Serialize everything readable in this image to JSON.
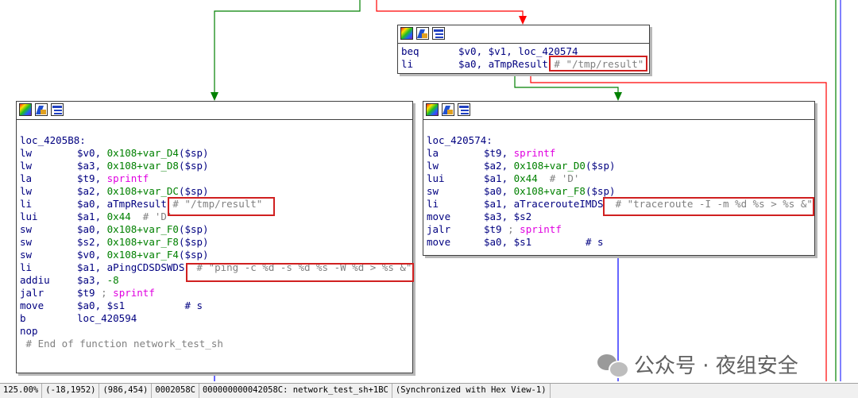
{
  "colors": {
    "mnemonic": "#000080",
    "function": "#e000e0",
    "number": "#008000",
    "comment": "#808080",
    "highlight": "#d02020",
    "edge_true": "#008000",
    "edge_false": "#ff0000",
    "edge_normal": "#0000ff"
  },
  "toolbar_icons": [
    "palette-icon",
    "edit-node-icon",
    "assembly-view-icon"
  ],
  "blocks": {
    "top": {
      "lines": [
        {
          "mn": "beq",
          "op": "$v0, $v1, loc_420574"
        },
        {
          "mn": "li",
          "op": "$a0, aTmpResult",
          "cm": "# \"/tmp/result\""
        }
      ]
    },
    "left": {
      "label": "loc_4205B8:",
      "lines": [
        {
          "mn": "lw",
          "op_pre": "$v0, ",
          "num": "0x108+var_D4",
          "op_post": "($sp)"
        },
        {
          "mn": "lw",
          "op_pre": "$a3, ",
          "num": "0x108+var_D8",
          "op_post": "($sp)"
        },
        {
          "mn": "la",
          "op_pre": "$t9, ",
          "fn": "sprintf"
        },
        {
          "mn": "lw",
          "op_pre": "$a2, ",
          "num": "0x108+var_DC",
          "op_post": "($sp)"
        },
        {
          "mn": "li",
          "op_pre": "$a0, aTmpResult ",
          "cm": "# \"/tmp/result\""
        },
        {
          "mn": "lui",
          "op_pre": "$a1, ",
          "num": "0x44",
          "cm": "  # 'D'"
        },
        {
          "mn": "sw",
          "op_pre": "$a0, ",
          "num": "0x108+var_F0",
          "op_post": "($sp)"
        },
        {
          "mn": "sw",
          "op_pre": "$s2, ",
          "num": "0x108+var_F8",
          "op_post": "($sp)"
        },
        {
          "mn": "sw",
          "op_pre": "$v0, ",
          "num": "0x108+var_F4",
          "op_post": "($sp)"
        },
        {
          "mn": "li",
          "op_pre": "$a1, aPingCDSDSWDS",
          "cm": "  # \"ping -c %d -s %d %s -W %d > %s &\""
        },
        {
          "mn": "addiu",
          "op_pre": "$a3, ",
          "num": "-8"
        },
        {
          "mn": "jalr",
          "op_pre": "$t9 ",
          "cm_fn": "; ",
          "fn": "sprintf"
        },
        {
          "mn": "move",
          "op_pre": "$a0, $s1",
          "op_post": "          # s"
        },
        {
          "mn": "b",
          "op_pre": "loc_420594"
        },
        {
          "mn": "nop",
          "op_pre": ""
        }
      ],
      "footer": " # End of function network_test_sh"
    },
    "right": {
      "label": "loc_420574:",
      "lines": [
        {
          "mn": "la",
          "op_pre": "$t9, ",
          "fn": "sprintf"
        },
        {
          "mn": "lw",
          "op_pre": "$a2, ",
          "num": "0x108+var_D0",
          "op_post": "($sp)"
        },
        {
          "mn": "lui",
          "op_pre": "$a1, ",
          "num": "0x44",
          "cm": "  # 'D'"
        },
        {
          "mn": "sw",
          "op_pre": "$a0, ",
          "num": "0x108+var_F8",
          "op_post": "($sp)"
        },
        {
          "mn": "li",
          "op_pre": "$a1, aTracerouteIMDS",
          "cm": "  # \"traceroute -I -m %d %s > %s &\""
        },
        {
          "mn": "move",
          "op_pre": "$a3, $s2"
        },
        {
          "mn": "jalr",
          "op_pre": "$t9 ",
          "cm_fn": "; ",
          "fn": "sprintf"
        },
        {
          "mn": "move",
          "op_pre": "$a0, $s1",
          "op_post": "         # s"
        }
      ]
    }
  },
  "status_bar": {
    "zoom": "125.00%",
    "coords": "(-18,1952)",
    "cursor": "(986,454)",
    "offset": "0002058C",
    "address": "000000000042058C: network_test_sh+1BC",
    "sync": "(Synchronized with Hex View-1)"
  },
  "watermark": "公众号 · 夜组安全"
}
